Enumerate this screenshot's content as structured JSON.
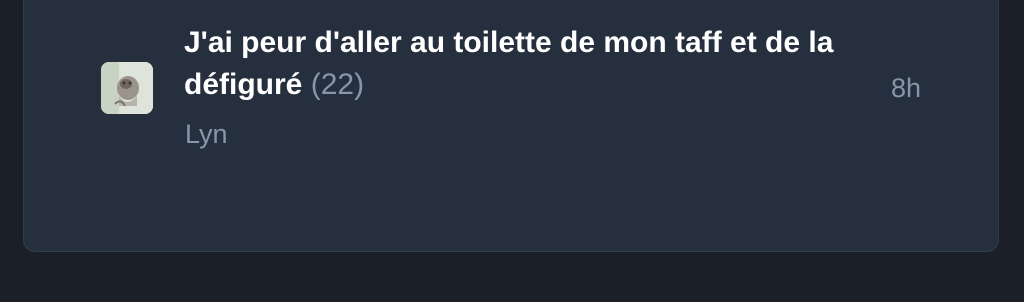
{
  "topic": {
    "title": "J'ai peur d'aller au toilette de mon taff et de la défiguré",
    "reply_count": "(22)",
    "author": "Lyn",
    "time": "8h",
    "avatar_icon": "user-avatar-icon"
  },
  "colors": {
    "background": "#1b2028",
    "card": "#262f3e",
    "title": "#ffffff",
    "muted": "#8896ab"
  }
}
